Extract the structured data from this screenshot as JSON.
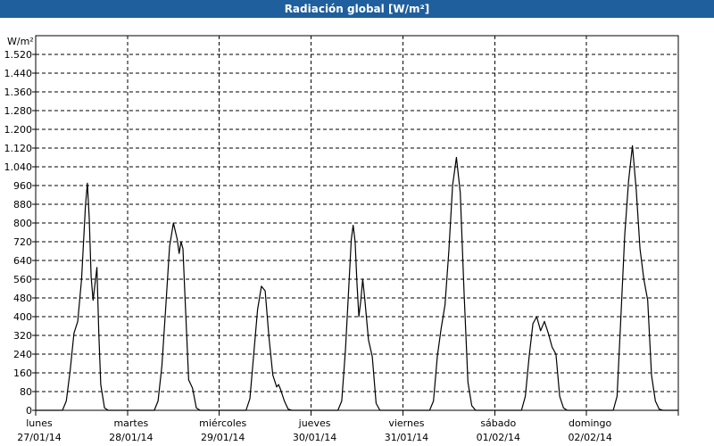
{
  "window": {
    "title": "Radiación global [W/m²]"
  },
  "chart_data": {
    "type": "line",
    "title": "Radiación global [W/m²]",
    "ylabel": "W/m²",
    "ylim": [
      0,
      1600
    ],
    "yticks": [
      0,
      80,
      160,
      240,
      320,
      400,
      480,
      560,
      640,
      720,
      800,
      880,
      960,
      1040,
      1120,
      1200,
      1280,
      1360,
      1440,
      1520
    ],
    "ytick_labels": [
      "0",
      "80",
      "160",
      "240",
      "320",
      "400",
      "480",
      "560",
      "640",
      "720",
      "800",
      "880",
      "960",
      "1.040",
      "1.120",
      "1.200",
      "1.280",
      "1.360",
      "1.440",
      "1.520"
    ],
    "xlim": [
      0,
      168
    ],
    "grid": true,
    "days": [
      {
        "weekday": "lunes",
        "date": "27/01/14"
      },
      {
        "weekday": "martes",
        "date": "28/01/14"
      },
      {
        "weekday": "miércoles",
        "date": "29/01/14"
      },
      {
        "weekday": "jueves",
        "date": "30/01/14"
      },
      {
        "weekday": "viernes",
        "date": "31/01/14"
      },
      {
        "weekday": "sábado",
        "date": "01/02/14"
      },
      {
        "weekday": "domingo",
        "date": "02/02/14"
      }
    ],
    "series": [
      {
        "color": "#000000",
        "points": [
          [
            0,
            0
          ],
          [
            7,
            0
          ],
          [
            8,
            40
          ],
          [
            9,
            170
          ],
          [
            10,
            330
          ],
          [
            11,
            380
          ],
          [
            12,
            560
          ],
          [
            13,
            870
          ],
          [
            13.5,
            970
          ],
          [
            14,
            820
          ],
          [
            14.5,
            570
          ],
          [
            15,
            470
          ],
          [
            16,
            610
          ],
          [
            16.5,
            330
          ],
          [
            17,
            110
          ],
          [
            18,
            10
          ],
          [
            19,
            0
          ],
          [
            31,
            0
          ],
          [
            32,
            40
          ],
          [
            33,
            190
          ],
          [
            34,
            440
          ],
          [
            35,
            700
          ],
          [
            36,
            800
          ],
          [
            37,
            730
          ],
          [
            37.5,
            670
          ],
          [
            38,
            720
          ],
          [
            38.5,
            690
          ],
          [
            39,
            500
          ],
          [
            40,
            130
          ],
          [
            41,
            95
          ],
          [
            42,
            10
          ],
          [
            43,
            0
          ],
          [
            55,
            0
          ],
          [
            56,
            50
          ],
          [
            57,
            240
          ],
          [
            58,
            430
          ],
          [
            59,
            530
          ],
          [
            60,
            510
          ],
          [
            61,
            310
          ],
          [
            62,
            150
          ],
          [
            63,
            100
          ],
          [
            63.5,
            110
          ],
          [
            64,
            90
          ],
          [
            65,
            40
          ],
          [
            66,
            5
          ],
          [
            67,
            0
          ],
          [
            79,
            0
          ],
          [
            80,
            40
          ],
          [
            81,
            260
          ],
          [
            82,
            570
          ],
          [
            82.5,
            730
          ],
          [
            83,
            790
          ],
          [
            83.5,
            720
          ],
          [
            84,
            540
          ],
          [
            84.5,
            400
          ],
          [
            85,
            470
          ],
          [
            85.5,
            560
          ],
          [
            86,
            480
          ],
          [
            87,
            300
          ],
          [
            88,
            230
          ],
          [
            89,
            30
          ],
          [
            90,
            0
          ],
          [
            103,
            0
          ],
          [
            104,
            40
          ],
          [
            105,
            230
          ],
          [
            106,
            350
          ],
          [
            107,
            450
          ],
          [
            108,
            680
          ],
          [
            109,
            960
          ],
          [
            110,
            1080
          ],
          [
            111,
            930
          ],
          [
            112,
            500
          ],
          [
            113,
            120
          ],
          [
            114,
            20
          ],
          [
            115,
            0
          ],
          [
            127,
            0
          ],
          [
            128,
            60
          ],
          [
            129,
            230
          ],
          [
            130,
            370
          ],
          [
            131,
            400
          ],
          [
            132,
            340
          ],
          [
            133,
            380
          ],
          [
            134,
            330
          ],
          [
            135,
            270
          ],
          [
            136,
            240
          ],
          [
            137,
            60
          ],
          [
            138,
            10
          ],
          [
            139,
            0
          ],
          [
            151,
            0
          ],
          [
            152,
            60
          ],
          [
            153,
            400
          ],
          [
            154,
            750
          ],
          [
            155,
            980
          ],
          [
            156,
            1130
          ],
          [
            157,
            940
          ],
          [
            158,
            690
          ],
          [
            159,
            560
          ],
          [
            160,
            470
          ],
          [
            161,
            150
          ],
          [
            162,
            40
          ],
          [
            163,
            5
          ],
          [
            164,
            0
          ],
          [
            168,
            0
          ]
        ]
      }
    ]
  }
}
